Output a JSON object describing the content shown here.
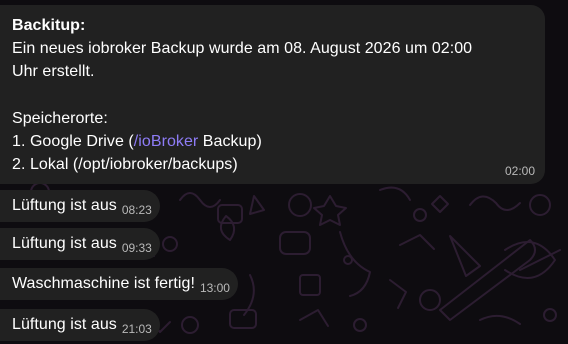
{
  "messages": {
    "main": {
      "sender": "Backitup:",
      "line1": "Ein neues iobroker Backup wurde am 08. August 2026 um 02:00",
      "line2": "Uhr erstellt.",
      "line3": "Speicherorte:",
      "line4_prefix": "1. Google Drive (",
      "line4_link": "/ioBroker",
      "line4_suffix": " Backup)",
      "line5": "2. Lokal (/opt/iobroker/backups)",
      "time": "02:00"
    },
    "short": [
      {
        "text": "Lüftung ist aus",
        "time": "08:23"
      },
      {
        "text": "Lüftung ist aus",
        "time": "09:33"
      },
      {
        "text": "Waschmaschine ist fertig!",
        "time": "13:00"
      },
      {
        "text": "Lüftung ist aus",
        "time": "21:03"
      }
    ]
  },
  "colors": {
    "background": "#0e0c10",
    "bubble": "#212121",
    "link": "#8e7cf6",
    "timestamp": "#b9b9b9",
    "doodle": "#2c1d31"
  }
}
